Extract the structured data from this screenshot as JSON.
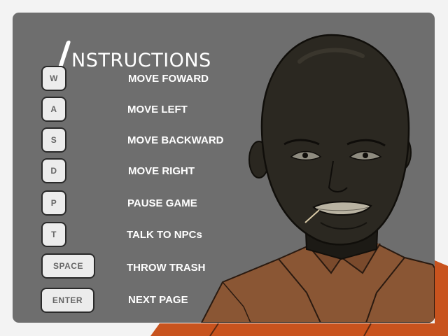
{
  "title": {
    "first_letter": "I",
    "rest": "NSTRUCTIONS"
  },
  "controls": [
    {
      "key": "W",
      "action": "MOVE FOWARD"
    },
    {
      "key": "A",
      "action": "MOVE LEFT"
    },
    {
      "key": "S",
      "action": "MOVE BACKWARD"
    },
    {
      "key": "D",
      "action": "MOVE RIGHT"
    },
    {
      "key": "P",
      "action": "PAUSE GAME"
    },
    {
      "key": "T",
      "action": "TALK TO NPCs"
    },
    {
      "key": "SPACE",
      "action": "THROW TRASH"
    },
    {
      "key": "ENTER",
      "action": "NEXT PAGE"
    }
  ],
  "colors": {
    "page_background": "#f3f3f3",
    "panel": "#6e6e6e",
    "key_face": "#ececec",
    "label_text": "#ffffff",
    "jumpsuit": "#c8531e"
  },
  "character": {
    "icon": "bald-prisoner-character-illustration"
  }
}
